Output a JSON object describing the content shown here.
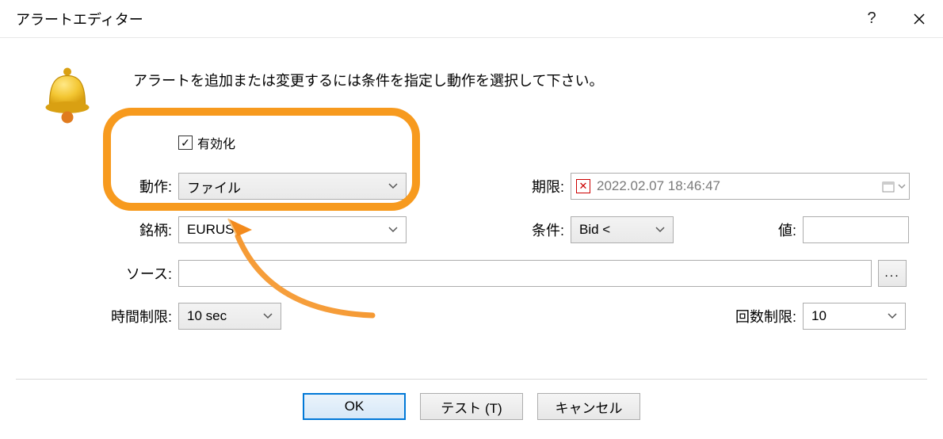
{
  "window": {
    "title": "アラートエディター"
  },
  "instruction": "アラートを追加または変更するには条件を指定し動作を選択して下さい。",
  "fields": {
    "enable_label": "有効化",
    "action_label": "動作:",
    "action_value": "ファイル",
    "symbol_label": "銘柄:",
    "symbol_value": "EURUSD",
    "expiry_label": "期限:",
    "expiry_value": "2022.02.07 18:46:47",
    "condition_label": "条件:",
    "condition_value": "Bid <",
    "value_label": "値:",
    "value_value": "",
    "source_label": "ソース:",
    "source_value": "",
    "timeout_label": "時間制限:",
    "timeout_value": "10 sec",
    "maxiter_label": "回数制限:",
    "maxiter_value": "10"
  },
  "buttons": {
    "ok": "OK",
    "test": "テスト (T)",
    "cancel": "キャンセル",
    "browse": "..."
  }
}
